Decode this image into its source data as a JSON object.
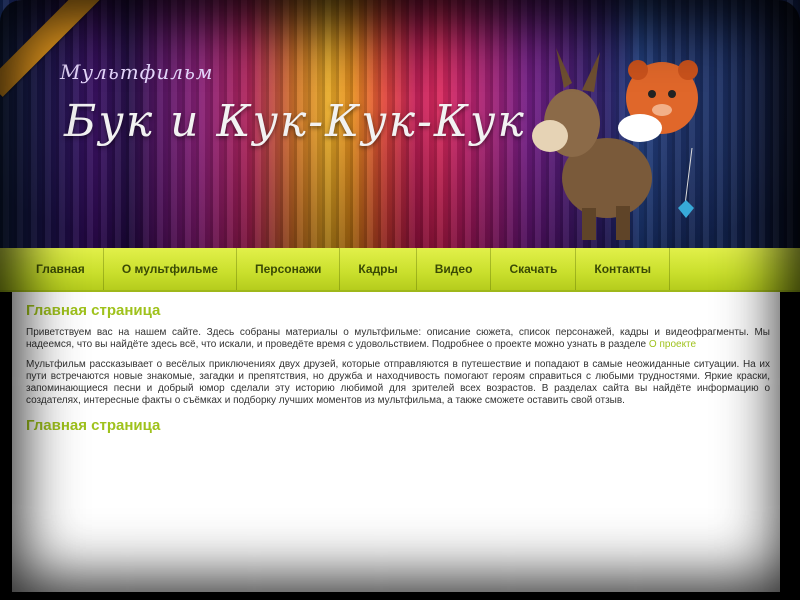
{
  "banner": {
    "subtitle": "Мультфильм",
    "title": "Бук и Кук-Кук-Кук"
  },
  "nav": {
    "items": [
      "Главная",
      "О мультфильме",
      "Персонажи",
      "Кадры",
      "Видео",
      "Скачать",
      "Контакты"
    ]
  },
  "content": {
    "section1": {
      "title": "Главная страница",
      "paragraph": "Приветствуем вас на нашем сайте. Здесь собраны материалы о мультфильме: описание сюжета, список персонажей, кадры и видеофрагменты. Мы надеемся, что вы найдёте здесь всё, что искали, и проведёте время с удовольствием. Подробнее о проекте можно узнать в разделе",
      "link": "О проекте"
    },
    "section2": {
      "paragraph": "Мультфильм рассказывает о весёлых приключениях двух друзей, которые отправляются в путешествие и попадают в самые неожиданные ситуации. На их пути встречаются новые знакомые, загадки и препятствия, но дружба и находчивость помогают героям справиться с любыми трудностями. Яркие краски, запоминающиеся песни и добрый юмор сделали эту историю любимой для зрителей всех возрастов. В разделах сайта вы найдёте информацию о создателях, интересные факты о съёмках и подборку лучших моментов из мультфильма, а также сможете оставить свой отзыв."
    },
    "section3": {
      "title": "Главная страница"
    }
  },
  "colors": {
    "nav_bg": "#c9df2c",
    "accent": "#9fc21c",
    "ribbon": "#f0a020"
  }
}
